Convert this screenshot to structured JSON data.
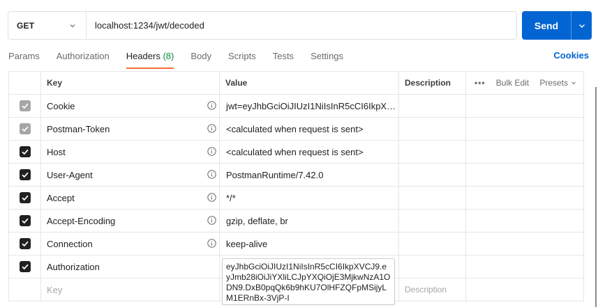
{
  "request": {
    "method": "GET",
    "url": "localhost:1234/jwt/decoded",
    "send_label": "Send"
  },
  "tabs": [
    {
      "label": "Params"
    },
    {
      "label": "Authorization"
    },
    {
      "label": "Headers",
      "count": "(8)",
      "active": true
    },
    {
      "label": "Body"
    },
    {
      "label": "Scripts"
    },
    {
      "label": "Tests"
    },
    {
      "label": "Settings"
    }
  ],
  "cookies_label": "Cookies",
  "table": {
    "columns": {
      "key": "Key",
      "value": "Value",
      "description": "Description"
    },
    "bulk_edit": "Bulk Edit",
    "presets": "Presets",
    "rows": [
      {
        "key": "Cookie",
        "value": "jwt=eyJhbGciOiJIUzI1NiIsInR5cCI6IkpXV...",
        "checked": true,
        "disabled": true,
        "info": true
      },
      {
        "key": "Postman-Token",
        "value": "<calculated when request is sent>",
        "checked": true,
        "disabled": true,
        "info": true
      },
      {
        "key": "Host",
        "value": "<calculated when request is sent>",
        "checked": true,
        "disabled": false,
        "info": true
      },
      {
        "key": "User-Agent",
        "value": "PostmanRuntime/7.42.0",
        "checked": true,
        "disabled": false,
        "info": true
      },
      {
        "key": "Accept",
        "value": "*/*",
        "checked": true,
        "disabled": false,
        "info": true
      },
      {
        "key": "Accept-Encoding",
        "value": "gzip, deflate, br",
        "checked": true,
        "disabled": false,
        "info": true
      },
      {
        "key": "Connection",
        "value": "keep-alive",
        "checked": true,
        "disabled": false,
        "info": true
      },
      {
        "key": "Authorization",
        "value": "eyJhbGciOiJIUzI1NiIsInR5cCI6IkpXVCJ9.eyJmb28iOiJiYXliLCJpYXQiOjE3MjkwNzA1ODN9.DxB0pqQk6b9hKU7OlHFZQFpMSijyLM1ERnBx-3VjP-I",
        "checked": true,
        "disabled": false,
        "info": false
      }
    ],
    "new_row": {
      "key_placeholder": "Key",
      "description_placeholder": "Description"
    }
  },
  "colors": {
    "accent": "#0265d2",
    "active_tab_underline": "#ff6c37",
    "count": "#0f8a3c"
  }
}
